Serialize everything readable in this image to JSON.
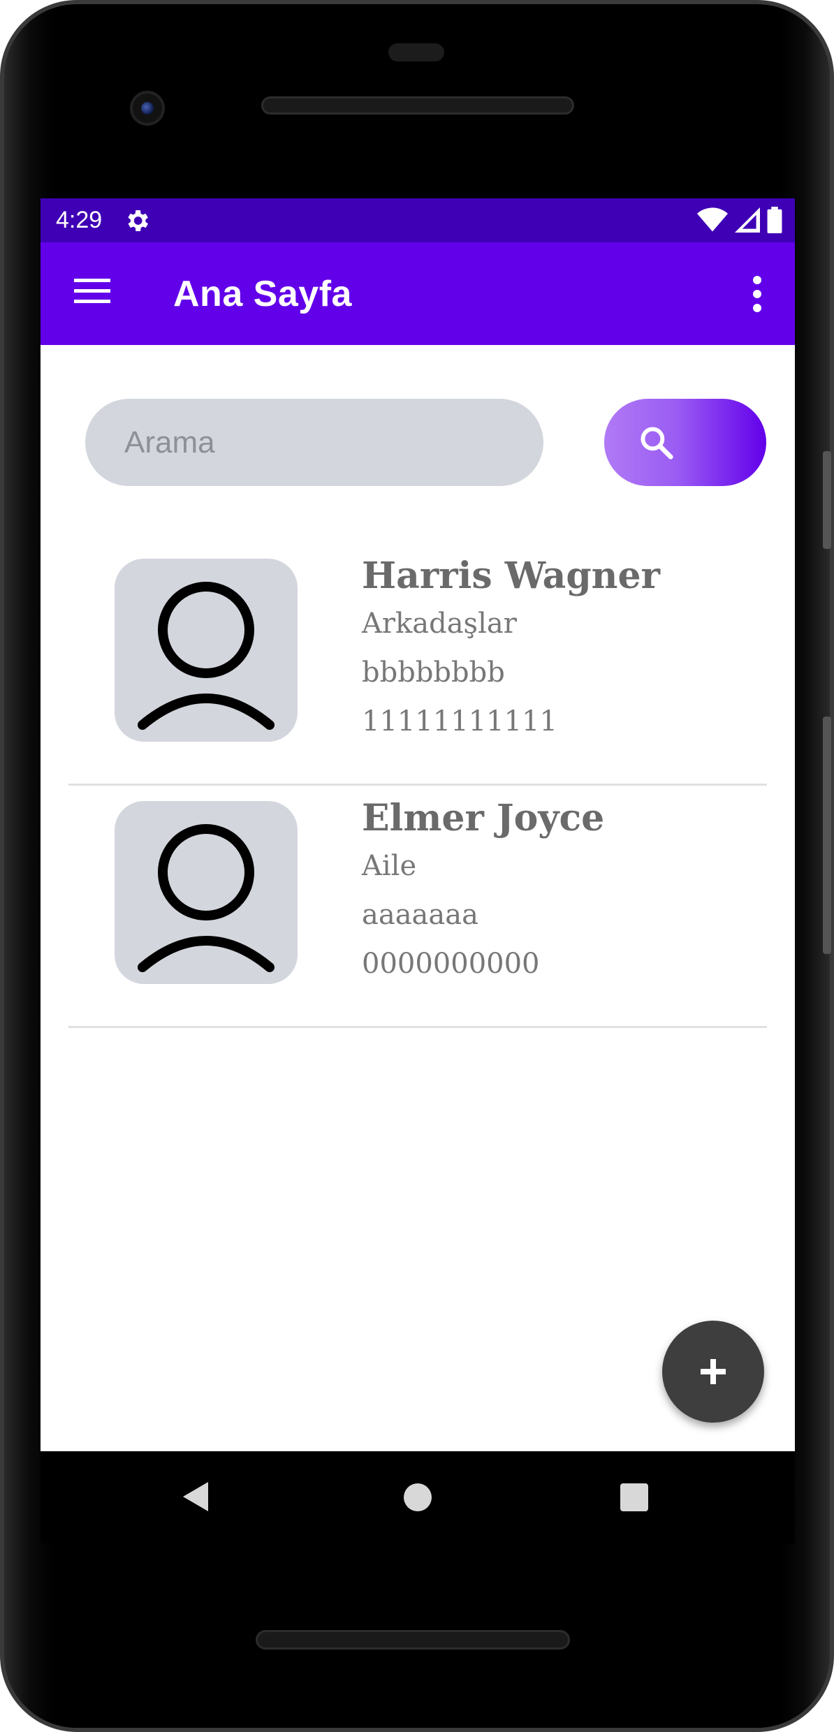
{
  "status_bar": {
    "time": "4:29",
    "icons": [
      "settings-gear-icon",
      "wifi-icon",
      "signal-icon",
      "battery-icon"
    ]
  },
  "app_bar": {
    "title": "Ana Sayfa",
    "menu_icon": "hamburger-menu-icon",
    "overflow_icon": "more-vert-icon"
  },
  "search": {
    "placeholder": "Arama",
    "value": "",
    "button_icon": "search-icon"
  },
  "contacts": [
    {
      "name": "Harris Wagner",
      "group": "Arkadaşlar",
      "note": "bbbbbbbb",
      "phone": "11111111111"
    },
    {
      "name": "Elmer Joyce",
      "group": "Aile",
      "note": "aaaaaaa",
      "phone": "0000000000"
    }
  ],
  "fab": {
    "icon": "add-icon",
    "symbol": "+"
  },
  "colors": {
    "status_bar": "#3f00b5",
    "app_bar": "#6200ea",
    "search_field": "#d3d6dd",
    "fab": "#3e3e3e"
  }
}
